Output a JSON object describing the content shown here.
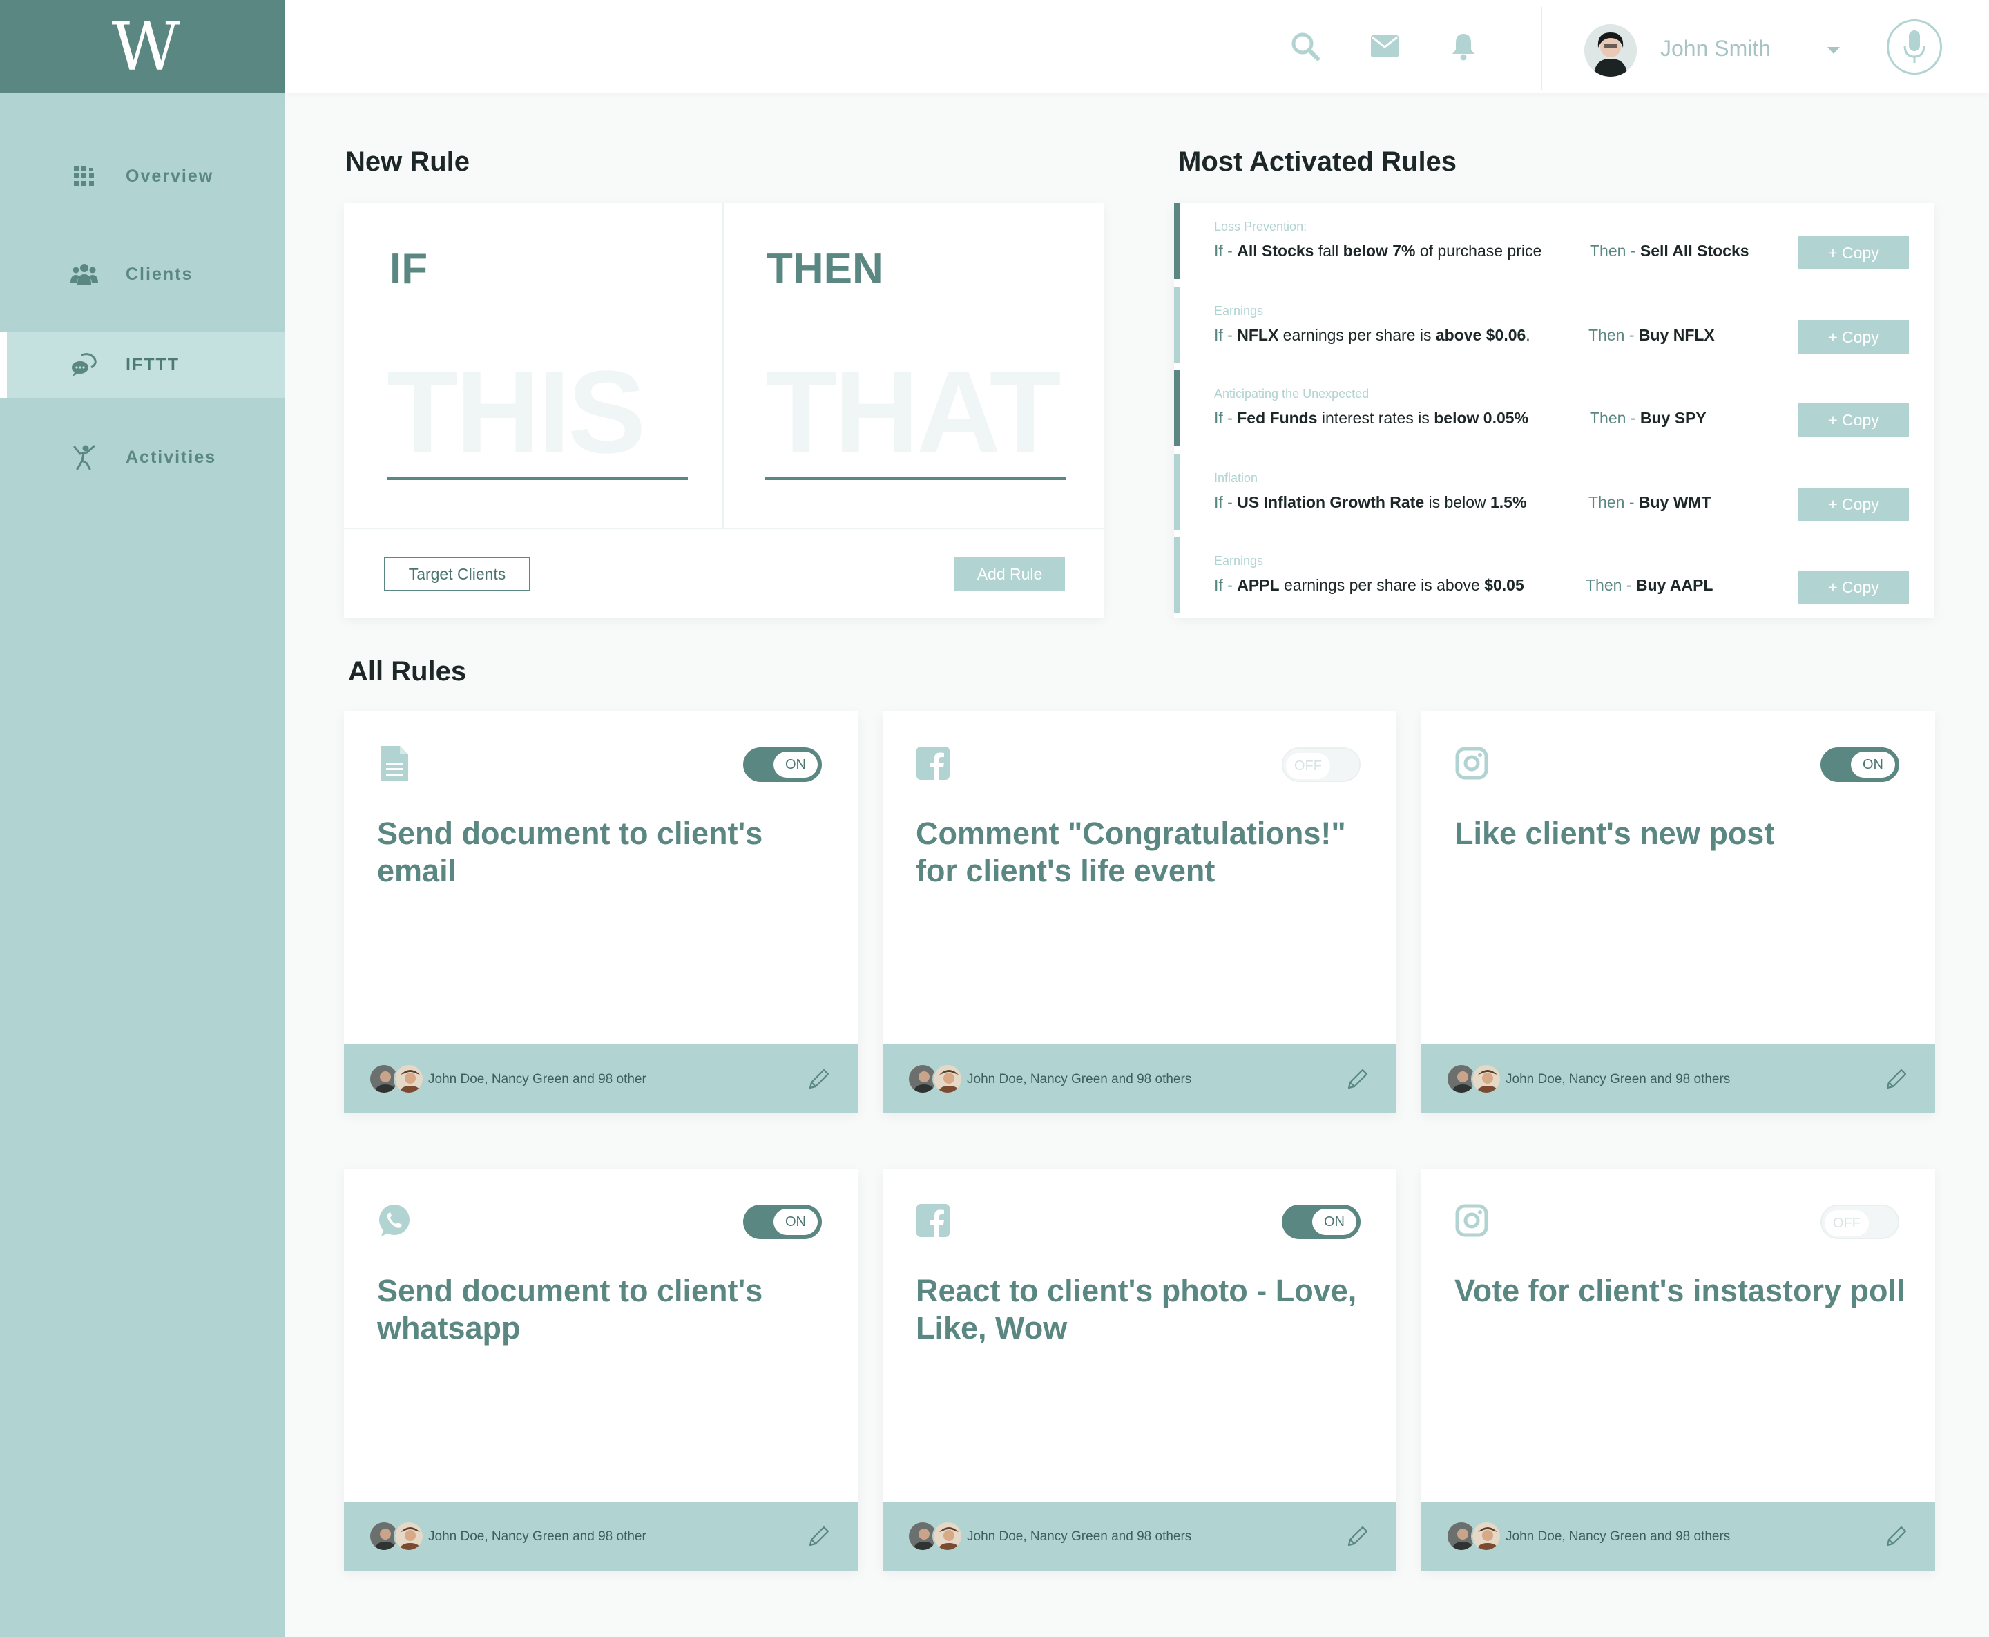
{
  "logo": "W",
  "sidebar": {
    "items": [
      {
        "label": "Overview",
        "icon": "grid-icon"
      },
      {
        "label": "Clients",
        "icon": "users-icon"
      },
      {
        "label": "IFTTT",
        "icon": "chat-bubbles-icon"
      },
      {
        "label": "Activities",
        "icon": "running-figure-icon"
      }
    ],
    "active": "IFTTT"
  },
  "header": {
    "icons": [
      "search-icon",
      "mail-icon",
      "bell-icon"
    ],
    "user_name": "John Smith"
  },
  "new_rule": {
    "title": "New Rule",
    "if_label": "IF",
    "then_label": "THEN",
    "this_placeholder": "THIS",
    "that_placeholder": "THAT",
    "target_clients_label": "Target Clients",
    "add_rule_label": "Add Rule"
  },
  "most_activated": {
    "title": "Most Activated Rules",
    "copy_label": "+ Copy",
    "rows": [
      {
        "category": "Loss Prevention:",
        "if_kw": "If -",
        "if_parts": [
          "All Stocks",
          " fall ",
          "below 7%",
          " of purchase price"
        ],
        "then_kw": "Then -",
        "then_action": "Sell All Stocks"
      },
      {
        "category": "Earnings",
        "if_kw": "If -",
        "if_parts": [
          "NFLX",
          " earnings per share is ",
          "above $0.06",
          "."
        ],
        "then_kw": "Then -",
        "then_action": "Buy NFLX"
      },
      {
        "category": "Anticipating the Unexpected",
        "if_kw": "If -",
        "if_parts": [
          "Fed Funds",
          " interest rates is ",
          "below 0.05%",
          ""
        ],
        "then_kw": "Then -",
        "then_action": "Buy SPY"
      },
      {
        "category": "Inflation",
        "if_kw": "If -",
        "if_parts": [
          "US Inflation Growth Rate",
          " is below ",
          "1.5%",
          ""
        ],
        "then_kw": "Then -",
        "then_action": "Buy WMT"
      },
      {
        "category": "Earnings",
        "if_kw": "If -",
        "if_parts": [
          "APPL",
          " earnings per share is above ",
          "$0.05",
          ""
        ],
        "then_kw": "Then -",
        "then_action": "Buy AAPL"
      }
    ]
  },
  "all_rules": {
    "title": "All Rules",
    "on_label": "ON",
    "off_label": "OFF",
    "cards": [
      {
        "icon": "document-icon",
        "state": "on",
        "title": "Send document to client's email",
        "audience": "John Doe, Nancy Green and 98 other"
      },
      {
        "icon": "facebook-icon",
        "state": "off",
        "title": "Comment \"Congratulations!\" for client's life event",
        "audience": "John Doe, Nancy Green and 98 others"
      },
      {
        "icon": "instagram-icon",
        "state": "on",
        "title": "Like client's new post",
        "audience": "John Doe, Nancy Green and 98 others"
      },
      {
        "icon": "whatsapp-icon",
        "state": "on",
        "title": "Send document to client's whatsapp",
        "audience": "John Doe, Nancy Green and 98 other"
      },
      {
        "icon": "facebook-icon",
        "state": "on",
        "title": "React to client's photo - Love, Like, Wow",
        "audience": "John Doe, Nancy Green and 98 others"
      },
      {
        "icon": "instagram-icon",
        "state": "off",
        "title": "Vote for client's instastory poll",
        "audience": "John Doe, Nancy Green and 98 others"
      }
    ]
  },
  "colors": {
    "primary": "#5a8782",
    "light": "#b1d3d2",
    "background": "#f8f9f9"
  }
}
